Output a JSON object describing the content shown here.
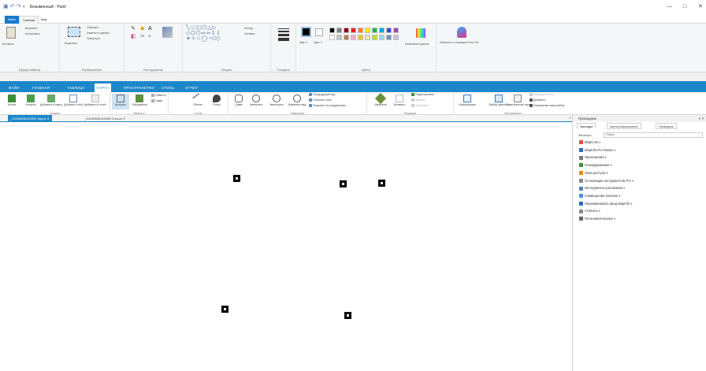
{
  "paint": {
    "title": "Безымянный - Paint",
    "quick_access": [
      "▣",
      "↶",
      "↷",
      "▾"
    ],
    "window_controls": [
      "—",
      "□",
      "✕"
    ],
    "tabs": [
      "Файл",
      "Главная",
      "Вид"
    ],
    "groups": {
      "clipboard": {
        "label": "Буфер обмена",
        "paste": "Вставить",
        "cut": "Вырезать",
        "copy": "Копировать"
      },
      "image": {
        "label": "Изображение",
        "select": "Выделить",
        "crop": "Обрезать",
        "resize": "Изменить размер",
        "rotate": "Повернуть"
      },
      "tools": {
        "label": "Инструменты"
      },
      "shapes": {
        "label": "Фигуры",
        "outline": "Контур",
        "fill": "Заливка"
      },
      "size": {
        "label": "Толщина"
      },
      "colors": {
        "label": "Цвета",
        "color1": "Цвет 1",
        "color2": "Цвет 2",
        "edit": "Изменение цветов",
        "palette_top": [
          "#000000",
          "#7f7f7f",
          "#880015",
          "#ed1c24",
          "#ff7f27",
          "#fff200",
          "#22b14c",
          "#00a2e8",
          "#3f48cc",
          "#a349a4"
        ],
        "palette_bottom": [
          "#ffffff",
          "#c3c3c3",
          "#b97a57",
          "#ffaec9",
          "#ffc90e",
          "#efe4b0",
          "#b5e61d",
          "#99d9ea",
          "#7092be",
          "#c8bfe7"
        ]
      },
      "paint3d": {
        "label": "Изменить с помощью Paint 3D"
      }
    }
  },
  "mapinfo": {
    "tabs": [
      "ФАЙЛ",
      "ГЛАВНАЯ",
      "ТАБЛИЦА",
      "КАРТА",
      "ПРОСТРАНСТВО",
      "СТИЛЬ",
      "ОТЧЕТ"
    ],
    "active_tab": "КАРТА",
    "groups": {
      "create": {
        "label": "Создать",
        "buttons": [
          "Клоны",
          "Открыть",
          "Добавить в карту",
          "Добавить слой",
          "Добавить в отчёт"
        ]
      },
      "select": {
        "label": "Выбрать",
        "buttons": [
          "Выбрать",
          "Объединить"
        ],
        "small": [
          "Обвести",
          "Сдвиг"
        ]
      },
      "styles": {
        "label": "Стили",
        "buttons": [
          "Объект",
          "Стиль"
        ]
      },
      "navigation": {
        "label": "Навигация",
        "buttons": [
          "Сдвиг",
          "Увеличить",
          "Уменьшить",
          "Изменить вид"
        ],
        "small": [
          "Предыдущий вид",
          "Показать слой",
          "Показать по координатам"
        ]
      },
      "edit": {
        "label": "Редакция",
        "buttons": [
          "Изменить",
          "Вставить"
        ],
        "small": [
          "Редактировать",
          "Удалить",
          "Отменить"
        ]
      },
      "tools": {
        "label": "Инструменты",
        "buttons": [
          "Информация",
          "Выбор крупных",
          "Тематические карты"
        ],
        "small": [
          "Легенда отчёта",
          "Добавить",
          "Управление масштабом"
        ]
      }
    }
  },
  "documents": {
    "tabs": [
      {
        "label": "_20230606133002 Карта",
        "active": true
      },
      {
        "label": "_20230606133008 Список",
        "active": false
      }
    ],
    "scroll_hint": "◂"
  },
  "explorer": {
    "title": "Проводник",
    "controls": "▾ ✕",
    "subtabs": [
      "Закладки",
      "Картографирование",
      "Проводник"
    ],
    "filter_label": "Фильтры",
    "filter_value": "Поиск",
    "items": [
      {
        "label": "MapCAD",
        "color": "#d9534f"
      },
      {
        "label": "MapInfo Pro Raster",
        "color": "#2a6ebb"
      },
      {
        "label": "Приложения",
        "color": "#777777"
      },
      {
        "label": "Геокодирование",
        "color": "#3a8f3a"
      },
      {
        "label": "Окна доступа",
        "color": "#e08a1e"
      },
      {
        "label": "Установщик инструментов Pro",
        "color": "#888888"
      },
      {
        "label": "Инструменты рисования",
        "color": "#5a7fb5"
      },
      {
        "label": "Совмещение колонок",
        "color": "#4a90d9"
      },
      {
        "label": "Переименовать ввод MapInfo",
        "color": "#2a6ebb"
      },
      {
        "label": "Утилиты",
        "color": "#888888"
      },
      {
        "label": "Пользовательские",
        "color": "#666666"
      }
    ]
  },
  "map": {
    "points": 5
  }
}
